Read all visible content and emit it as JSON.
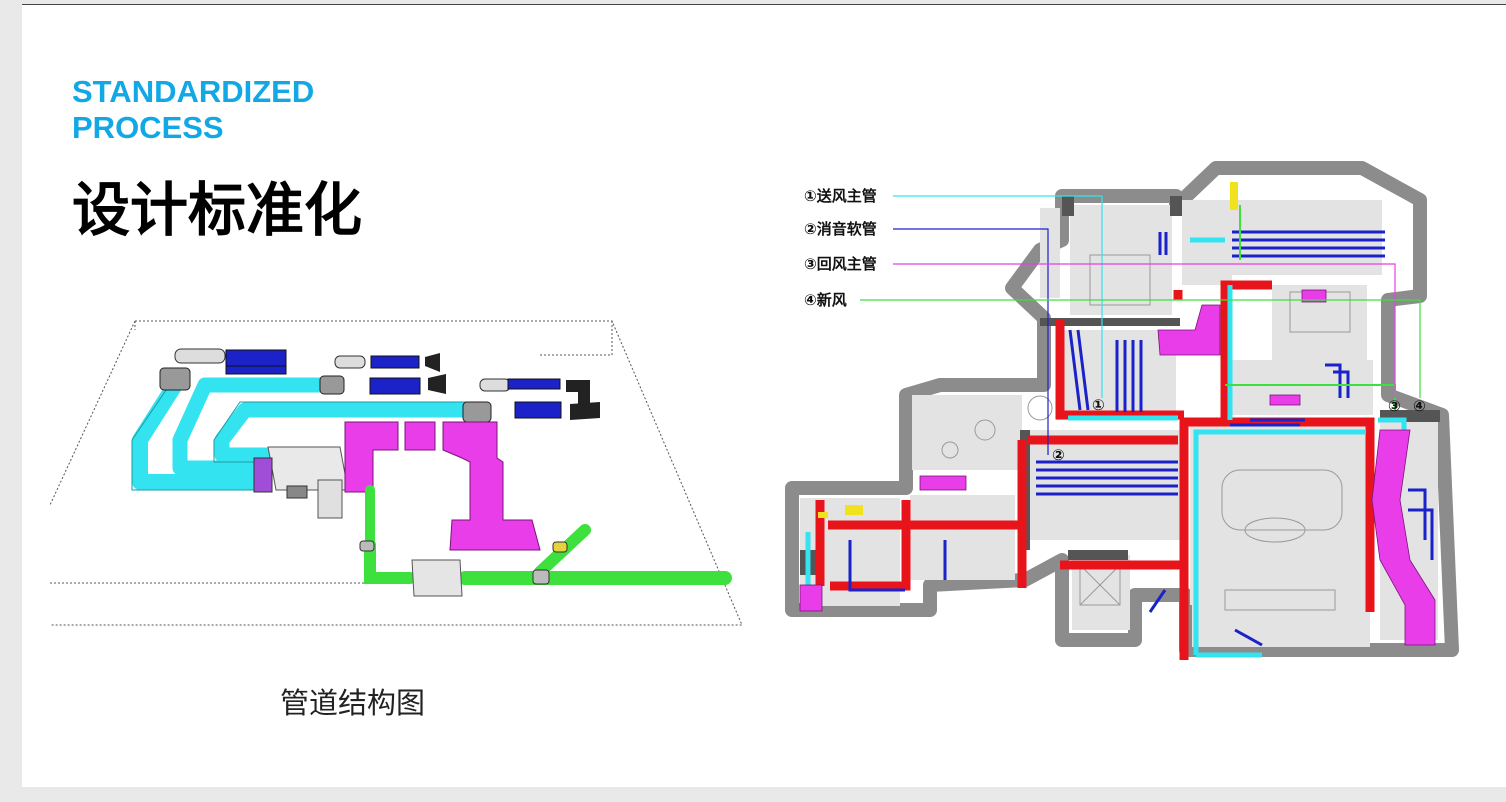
{
  "header": {
    "subtitle_line1": "STANDARDIZED",
    "subtitle_line2": "PROCESS",
    "title": "设计标准化"
  },
  "left_diagram": {
    "caption": "管道结构图"
  },
  "right_diagram": {
    "legend": [
      {
        "label": "①送风主管",
        "color": "#33e3ef"
      },
      {
        "label": "②消音软管",
        "color": "#1a22c8"
      },
      {
        "label": "③回风主管",
        "color": "#e83de8"
      },
      {
        "label": "④新风",
        "color": "#3ee03e"
      }
    ],
    "markers": [
      "①",
      "②",
      "③",
      "④"
    ]
  },
  "colors": {
    "accent": "#12a8e6",
    "supply_main": "#33e3ef",
    "silencer_hose": "#1a22c8",
    "return_main": "#e83de8",
    "fresh_air": "#3ee03e",
    "main_trunk": "#e8141c",
    "wall": "#8c8c8c"
  }
}
